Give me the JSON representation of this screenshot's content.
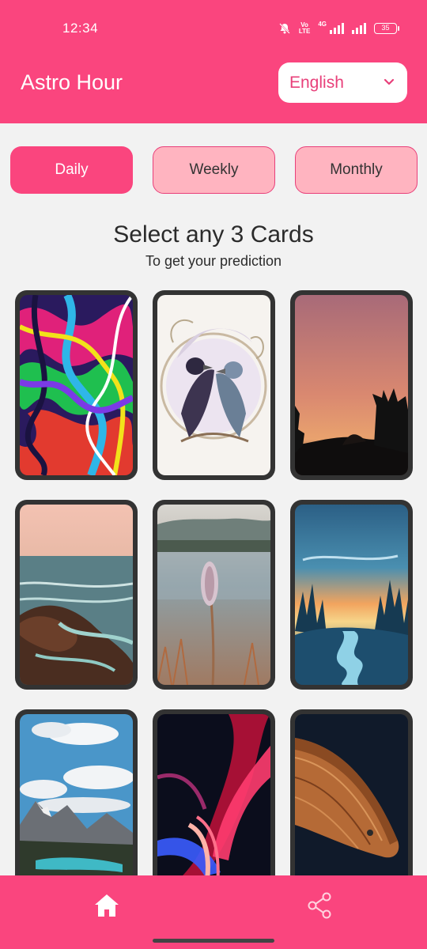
{
  "status_bar": {
    "time": "12:34",
    "volte_top": "Vo",
    "volte_bottom": "LTE",
    "network": "4G",
    "battery": "35"
  },
  "header": {
    "title": "Astro Hour",
    "language": {
      "selected": "English"
    }
  },
  "tabs": [
    {
      "label": "Daily",
      "active": true
    },
    {
      "label": "Weekly",
      "active": false
    },
    {
      "label": "Monthly",
      "active": false
    }
  ],
  "main": {
    "heading": "Select any 3 Cards",
    "subheading": "To get your prediction"
  },
  "cards": [
    {
      "image": "psychedelic-marble-swirl"
    },
    {
      "image": "two-ravens-illustration"
    },
    {
      "image": "sunset-tree-silhouette"
    },
    {
      "image": "rocky-coast-waves"
    },
    {
      "image": "lake-flower-closeup"
    },
    {
      "image": "forest-river-sunrise-illustration"
    },
    {
      "image": "mountain-lake-clouds"
    },
    {
      "image": "neon-light-trails"
    },
    {
      "image": "wooden-boat-bow"
    }
  ],
  "bottom_nav": [
    {
      "icon": "home-icon",
      "active": true
    },
    {
      "icon": "share-icon",
      "active": false
    }
  ],
  "colors": {
    "primary": "#fa457e",
    "tab_inactive": "#ffb4c0",
    "card_frame": "#333333",
    "background": "#f2f2f2"
  }
}
